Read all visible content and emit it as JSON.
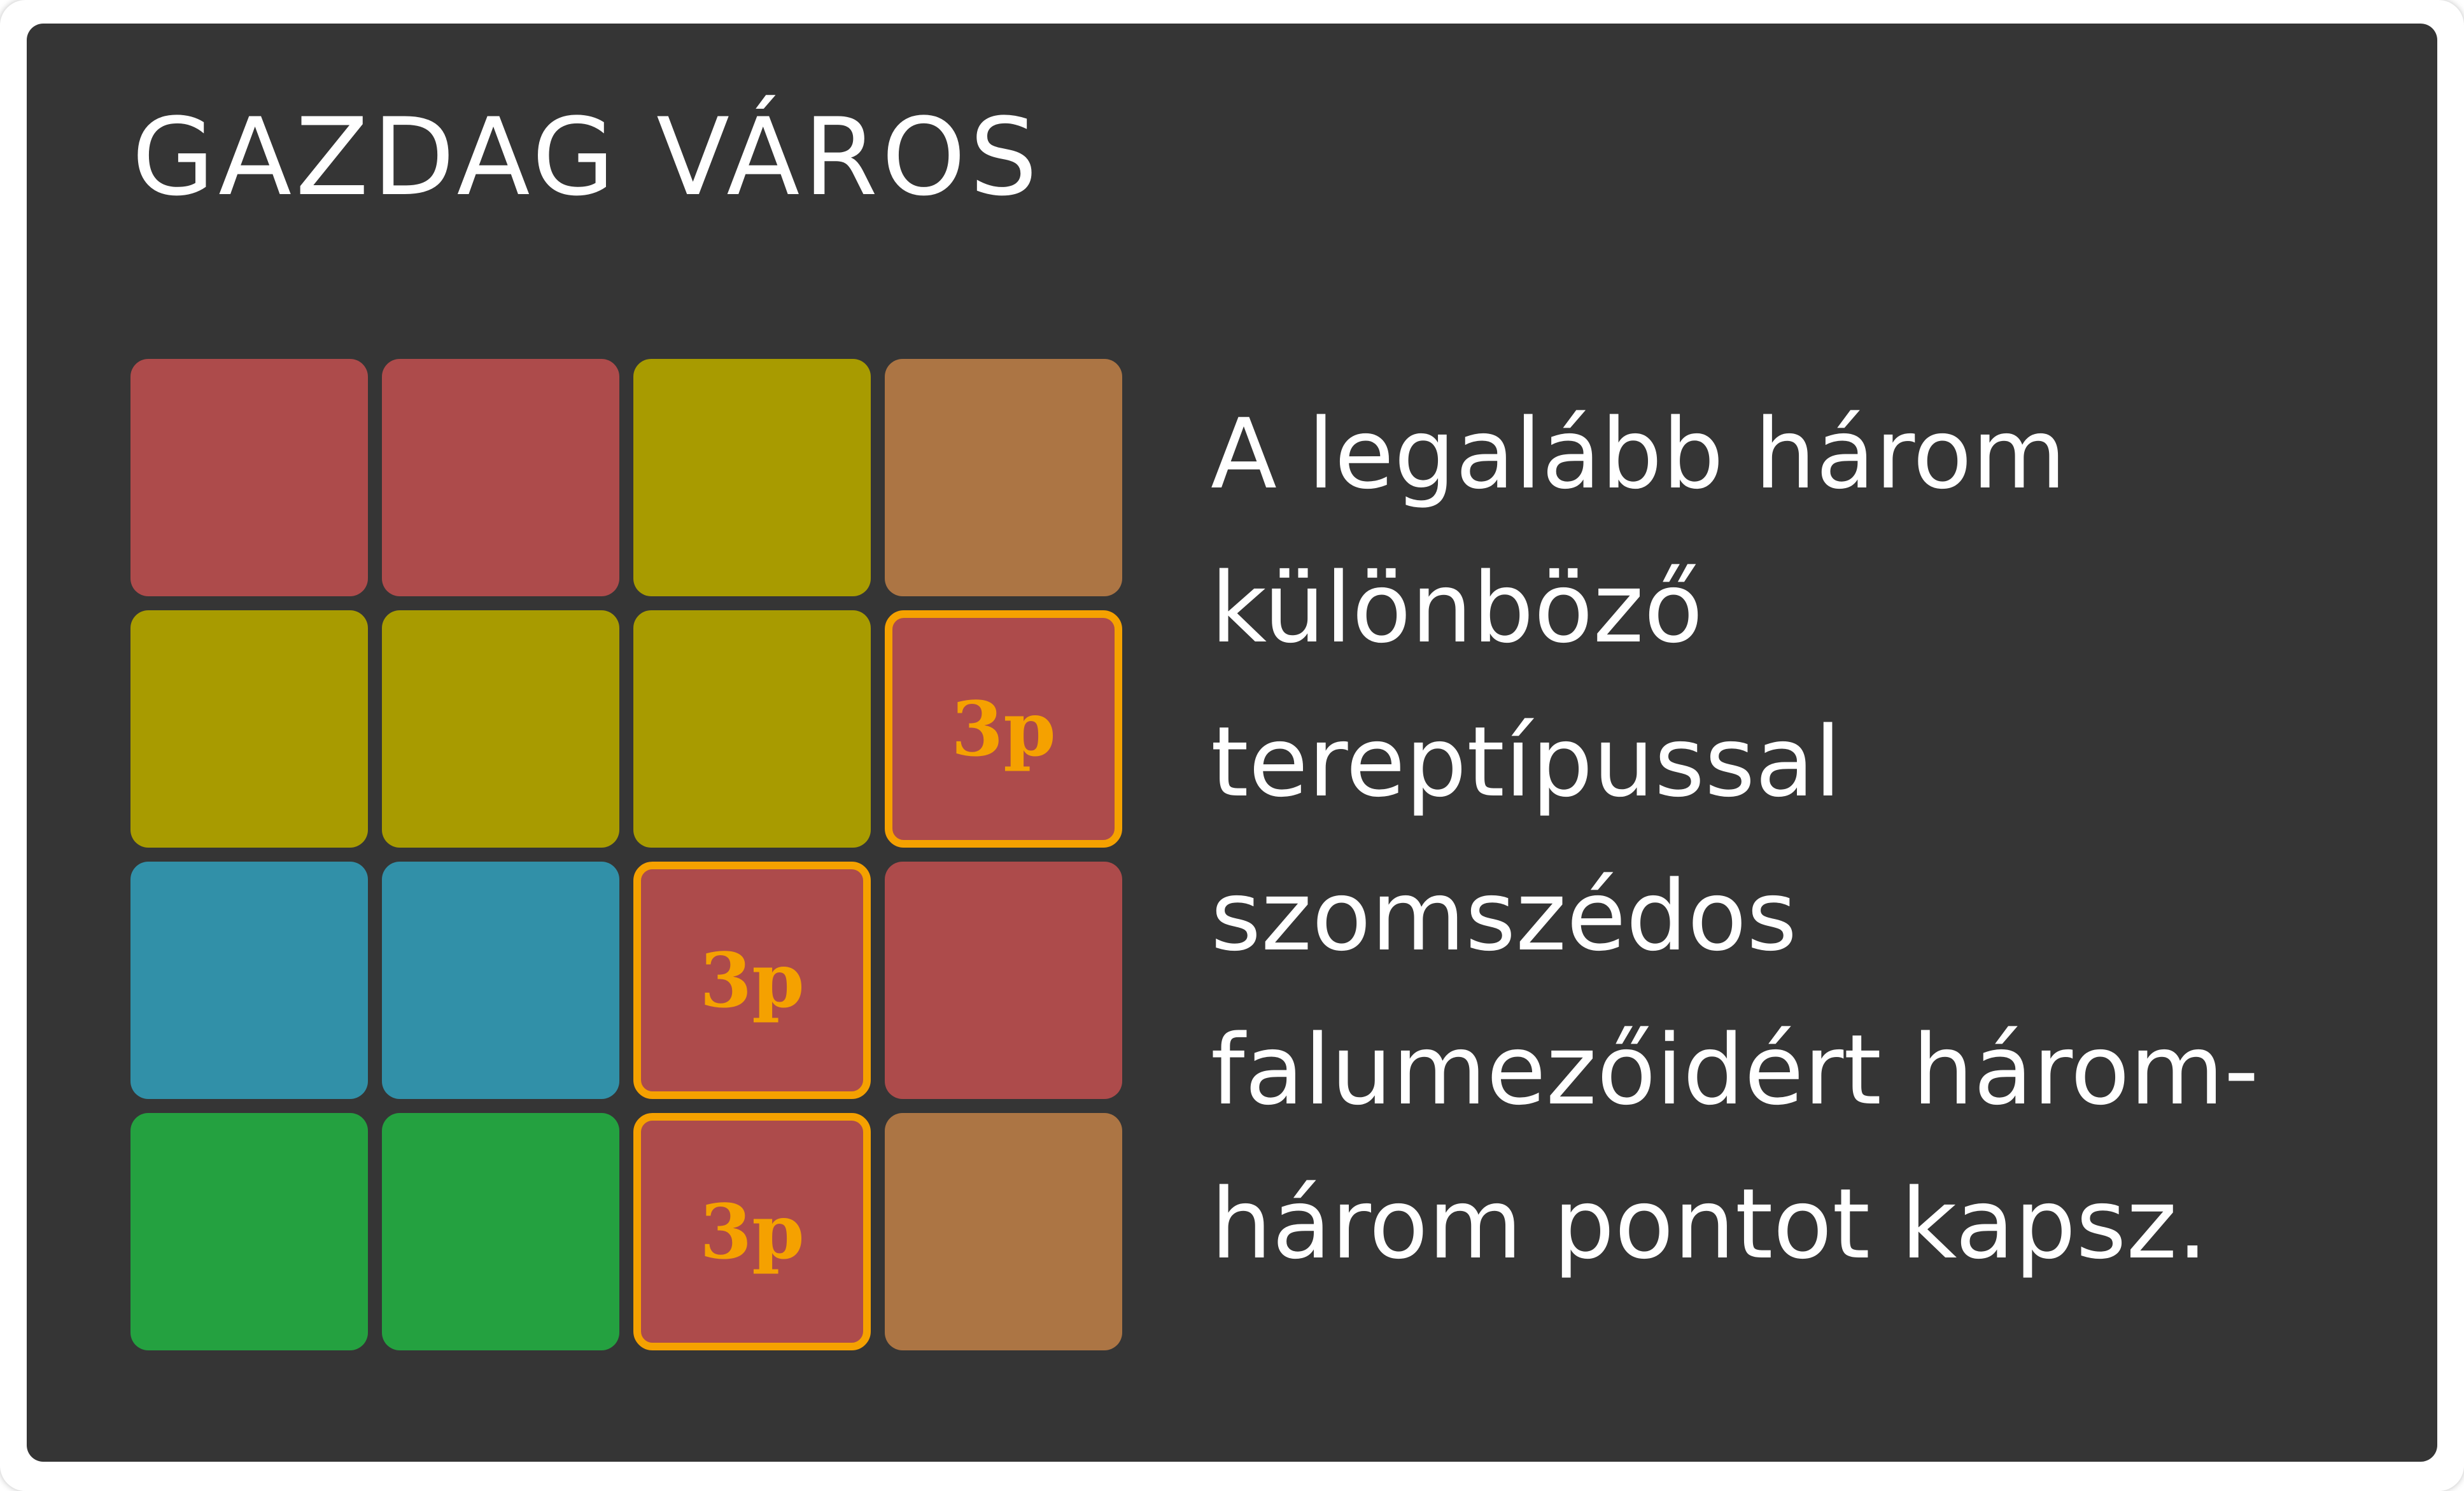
{
  "card": {
    "title": "GAZDAG VÁROS",
    "rule_lines": [
      "A legalább három",
      "különböző",
      "tereptípussal",
      "szomszédos",
      "falumezőidért három-",
      "három pontot kapsz."
    ]
  },
  "colors": {
    "card_background": "#353535",
    "village": "#ad4b4b",
    "farm": "#a89b00",
    "wasteland": "#ac7544",
    "water": "#3190a8",
    "forest": "#24a140",
    "score_highlight": "#f5a100"
  },
  "grid": {
    "rows": [
      [
        {
          "terrain": "village"
        },
        {
          "terrain": "village"
        },
        {
          "terrain": "farm"
        },
        {
          "terrain": "wasteland"
        }
      ],
      [
        {
          "terrain": "farm"
        },
        {
          "terrain": "farm"
        },
        {
          "terrain": "farm"
        },
        {
          "terrain": "village",
          "points": "3p"
        }
      ],
      [
        {
          "terrain": "water"
        },
        {
          "terrain": "water"
        },
        {
          "terrain": "village",
          "points": "3p"
        },
        {
          "terrain": "village"
        }
      ],
      [
        {
          "terrain": "forest"
        },
        {
          "terrain": "forest"
        },
        {
          "terrain": "village",
          "points": "3p"
        },
        {
          "terrain": "wasteland"
        }
      ]
    ]
  }
}
